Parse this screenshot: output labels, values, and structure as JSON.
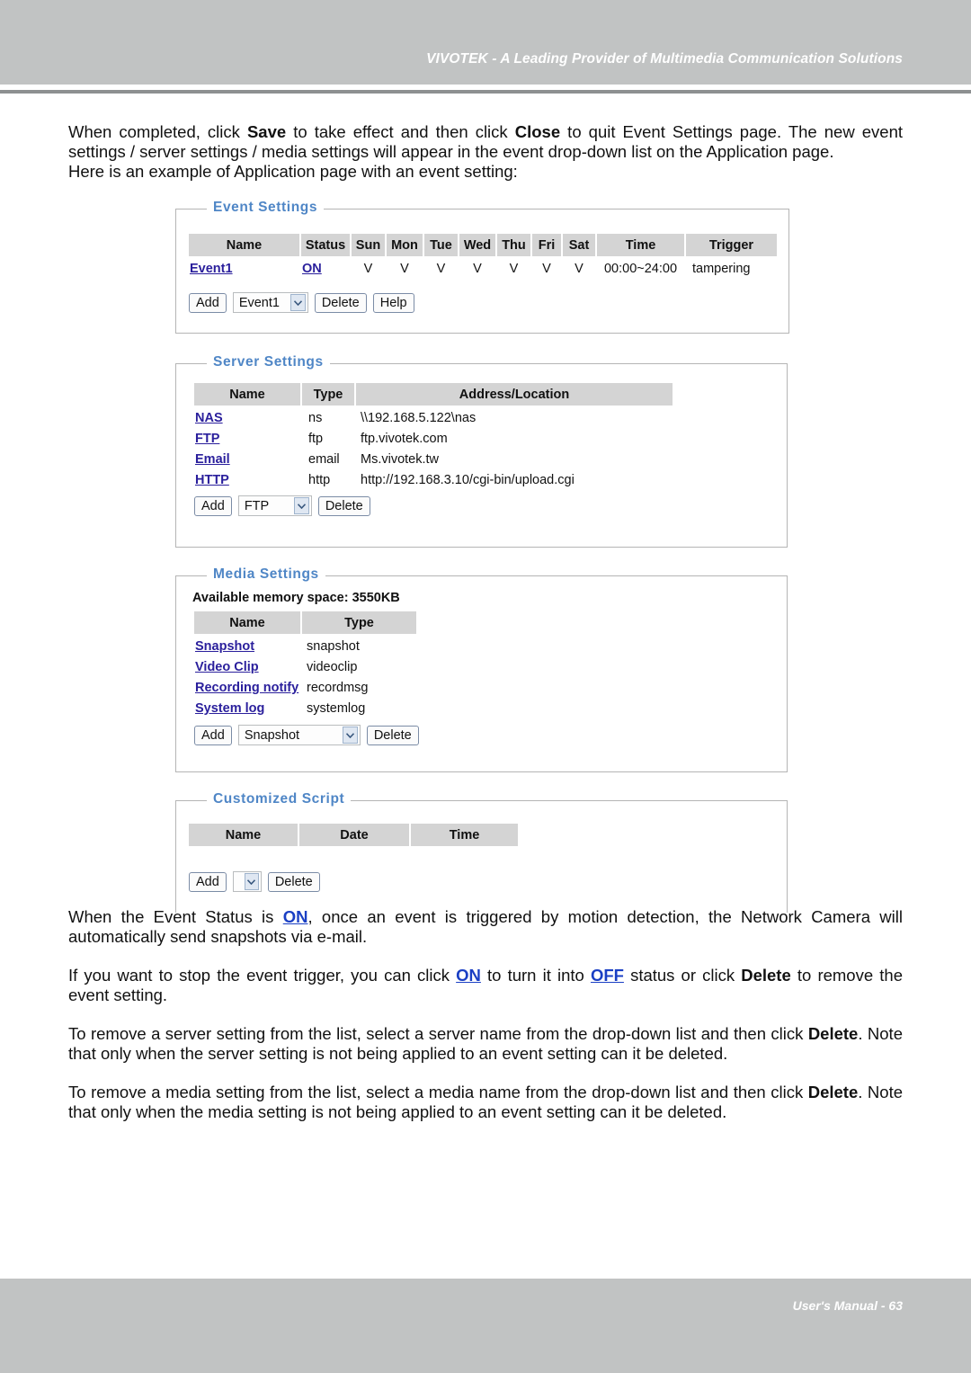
{
  "header": {
    "title": "VIVOTEK - A Leading Provider of Multimedia Communication Solutions"
  },
  "footer": {
    "text": "User's Manual - 63"
  },
  "intro": {
    "para1_a": "When completed, click ",
    "para1_save": "Save",
    "para1_b": " to take effect and then click ",
    "para1_close": "Close",
    "para1_c": " to quit Event Settings page. The new event settings / server settings / media settings will appear in the event drop-down list on the Application page.",
    "para2": "Here is an example of Application page with an event setting:"
  },
  "event_settings": {
    "legend": "Event Settings",
    "columns": [
      "Name",
      "Status",
      "Sun",
      "Mon",
      "Tue",
      "Wed",
      "Thu",
      "Fri",
      "Sat",
      "Time",
      "Trigger"
    ],
    "rows": [
      {
        "name": "Event1",
        "status": "ON",
        "sun": "V",
        "mon": "V",
        "tue": "V",
        "wed": "V",
        "thu": "V",
        "fri": "V",
        "sat": "V",
        "time": "00:00~24:00",
        "trigger": "tampering"
      }
    ],
    "controls": {
      "add": "Add",
      "select_value": "Event1",
      "delete": "Delete",
      "help": "Help"
    }
  },
  "server_settings": {
    "legend": "Server Settings",
    "columns": [
      "Name",
      "Type",
      "Address/Location"
    ],
    "rows": [
      {
        "name": "NAS",
        "type": "ns",
        "address": "\\\\192.168.5.122\\nas"
      },
      {
        "name": "FTP",
        "type": "ftp",
        "address": "ftp.vivotek.com"
      },
      {
        "name": "Email",
        "type": "email",
        "address": "Ms.vivotek.tw"
      },
      {
        "name": "HTTP",
        "type": "http",
        "address": "http://192.168.3.10/cgi-bin/upload.cgi"
      }
    ],
    "controls": {
      "add": "Add",
      "select_value": "FTP",
      "delete": "Delete"
    }
  },
  "media_settings": {
    "legend": "Media Settings",
    "memory": "Available memory space: 3550KB",
    "columns": [
      "Name",
      "Type"
    ],
    "rows": [
      {
        "name": "Snapshot",
        "type": "snapshot"
      },
      {
        "name": "Video Clip",
        "type": "videoclip"
      },
      {
        "name": "Recording notify",
        "type": "recordmsg"
      },
      {
        "name": "System log",
        "type": "systemlog"
      }
    ],
    "controls": {
      "add": "Add",
      "select_value": "Snapshot",
      "delete": "Delete"
    }
  },
  "customized_script": {
    "legend": "Customized Script",
    "columns": [
      "Name",
      "Date",
      "Time"
    ],
    "rows": [],
    "controls": {
      "add": "Add",
      "select_value": "",
      "delete": "Delete"
    }
  },
  "notes": {
    "p1_a": "When the Event Status is ",
    "p1_on": "ON",
    "p1_b": ", once an event is triggered by motion detection, the Network Camera will automatically send snapshots via e-mail.",
    "p2_a": "If you want to stop the event trigger, you can click ",
    "p2_on": "ON",
    "p2_b": " to turn it into ",
    "p2_off": "OFF",
    "p2_c": " status or click ",
    "p2_delete": "Delete",
    "p2_d": " to remove the event setting.",
    "p3_a": "To remove a server setting from the list, select a server name from the drop-down list and then click ",
    "p3_delete": "Delete",
    "p3_b": ". Note that only when the server setting is not being applied to an event setting can it be deleted.",
    "p4_a": "To remove a media setting from the list, select a media name from the drop-down list and then click ",
    "p4_delete": "Delete",
    "p4_b": ". Note that only when the media setting is not being applied to an event setting can it be deleted."
  },
  "colors": {
    "band": "#c1c3c3",
    "legend_blue": "#4f86c6",
    "link_blue": "#1a3fc4",
    "table_header": "#d4d4d4"
  }
}
